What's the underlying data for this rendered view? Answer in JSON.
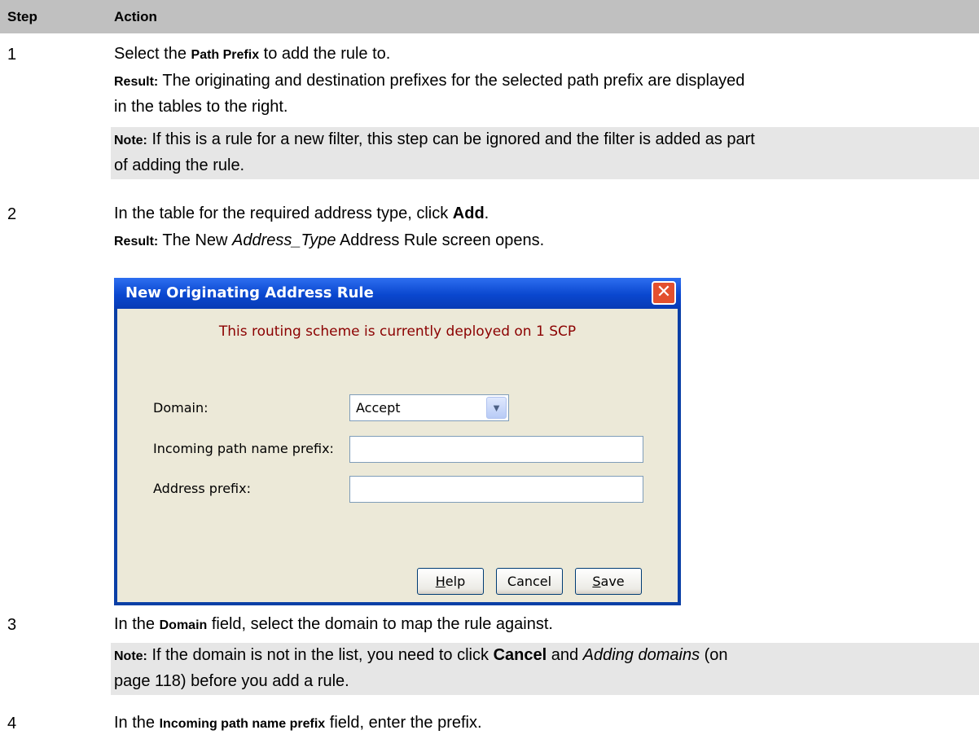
{
  "header": {
    "step": "Step",
    "action": "Action"
  },
  "step1": {
    "num": "1",
    "text_a": "Select the ",
    "text_b": "Path Prefix",
    "text_c": " to add the rule to.",
    "result_label": "Result:",
    "result_line1": " The originating and destination prefixes for the selected path prefix are displayed",
    "result_line2": "in the tables to the right.",
    "note_label": "Note:",
    "note_line1": " If this is a rule for a new filter, this step can be ignored and the filter is added as part",
    "note_line2": "of adding the rule."
  },
  "step2": {
    "num": "2",
    "text_a": "In the table for the required address type, click ",
    "text_b": "Add",
    "text_c": ".",
    "result_label": "Result:",
    "result_a": " The New ",
    "result_b": "Address_Type",
    "result_c": " Address Rule screen opens."
  },
  "dialog": {
    "title": "New Originating Address Rule",
    "close": "✕",
    "message": "This routing scheme is currently deployed on 1 SCP",
    "domain_label": "Domain:",
    "domain_value": "Accept",
    "incoming_label": "Incoming path name prefix:",
    "incoming_value": "",
    "address_label": "Address prefix:",
    "address_value": "",
    "help_a": "H",
    "help_b": "elp",
    "cancel": "Cancel",
    "save_a": "S",
    "save_b": "ave"
  },
  "step3": {
    "num": "3",
    "text_a": "In the ",
    "text_b": "Domain",
    "text_c": " field, select the domain to map the rule against.",
    "note_label": "Note:",
    "note_a": " If the domain is not in the list, you need to click ",
    "note_b": "Cancel",
    "note_c": " and ",
    "note_d": "Adding domains",
    "note_e": " (on",
    "note_line2": "page 118) before you add a rule."
  },
  "step4": {
    "num": "4",
    "text_a": "In the ",
    "text_b": "Incoming path name prefix",
    "text_c": " field, enter the prefix."
  }
}
